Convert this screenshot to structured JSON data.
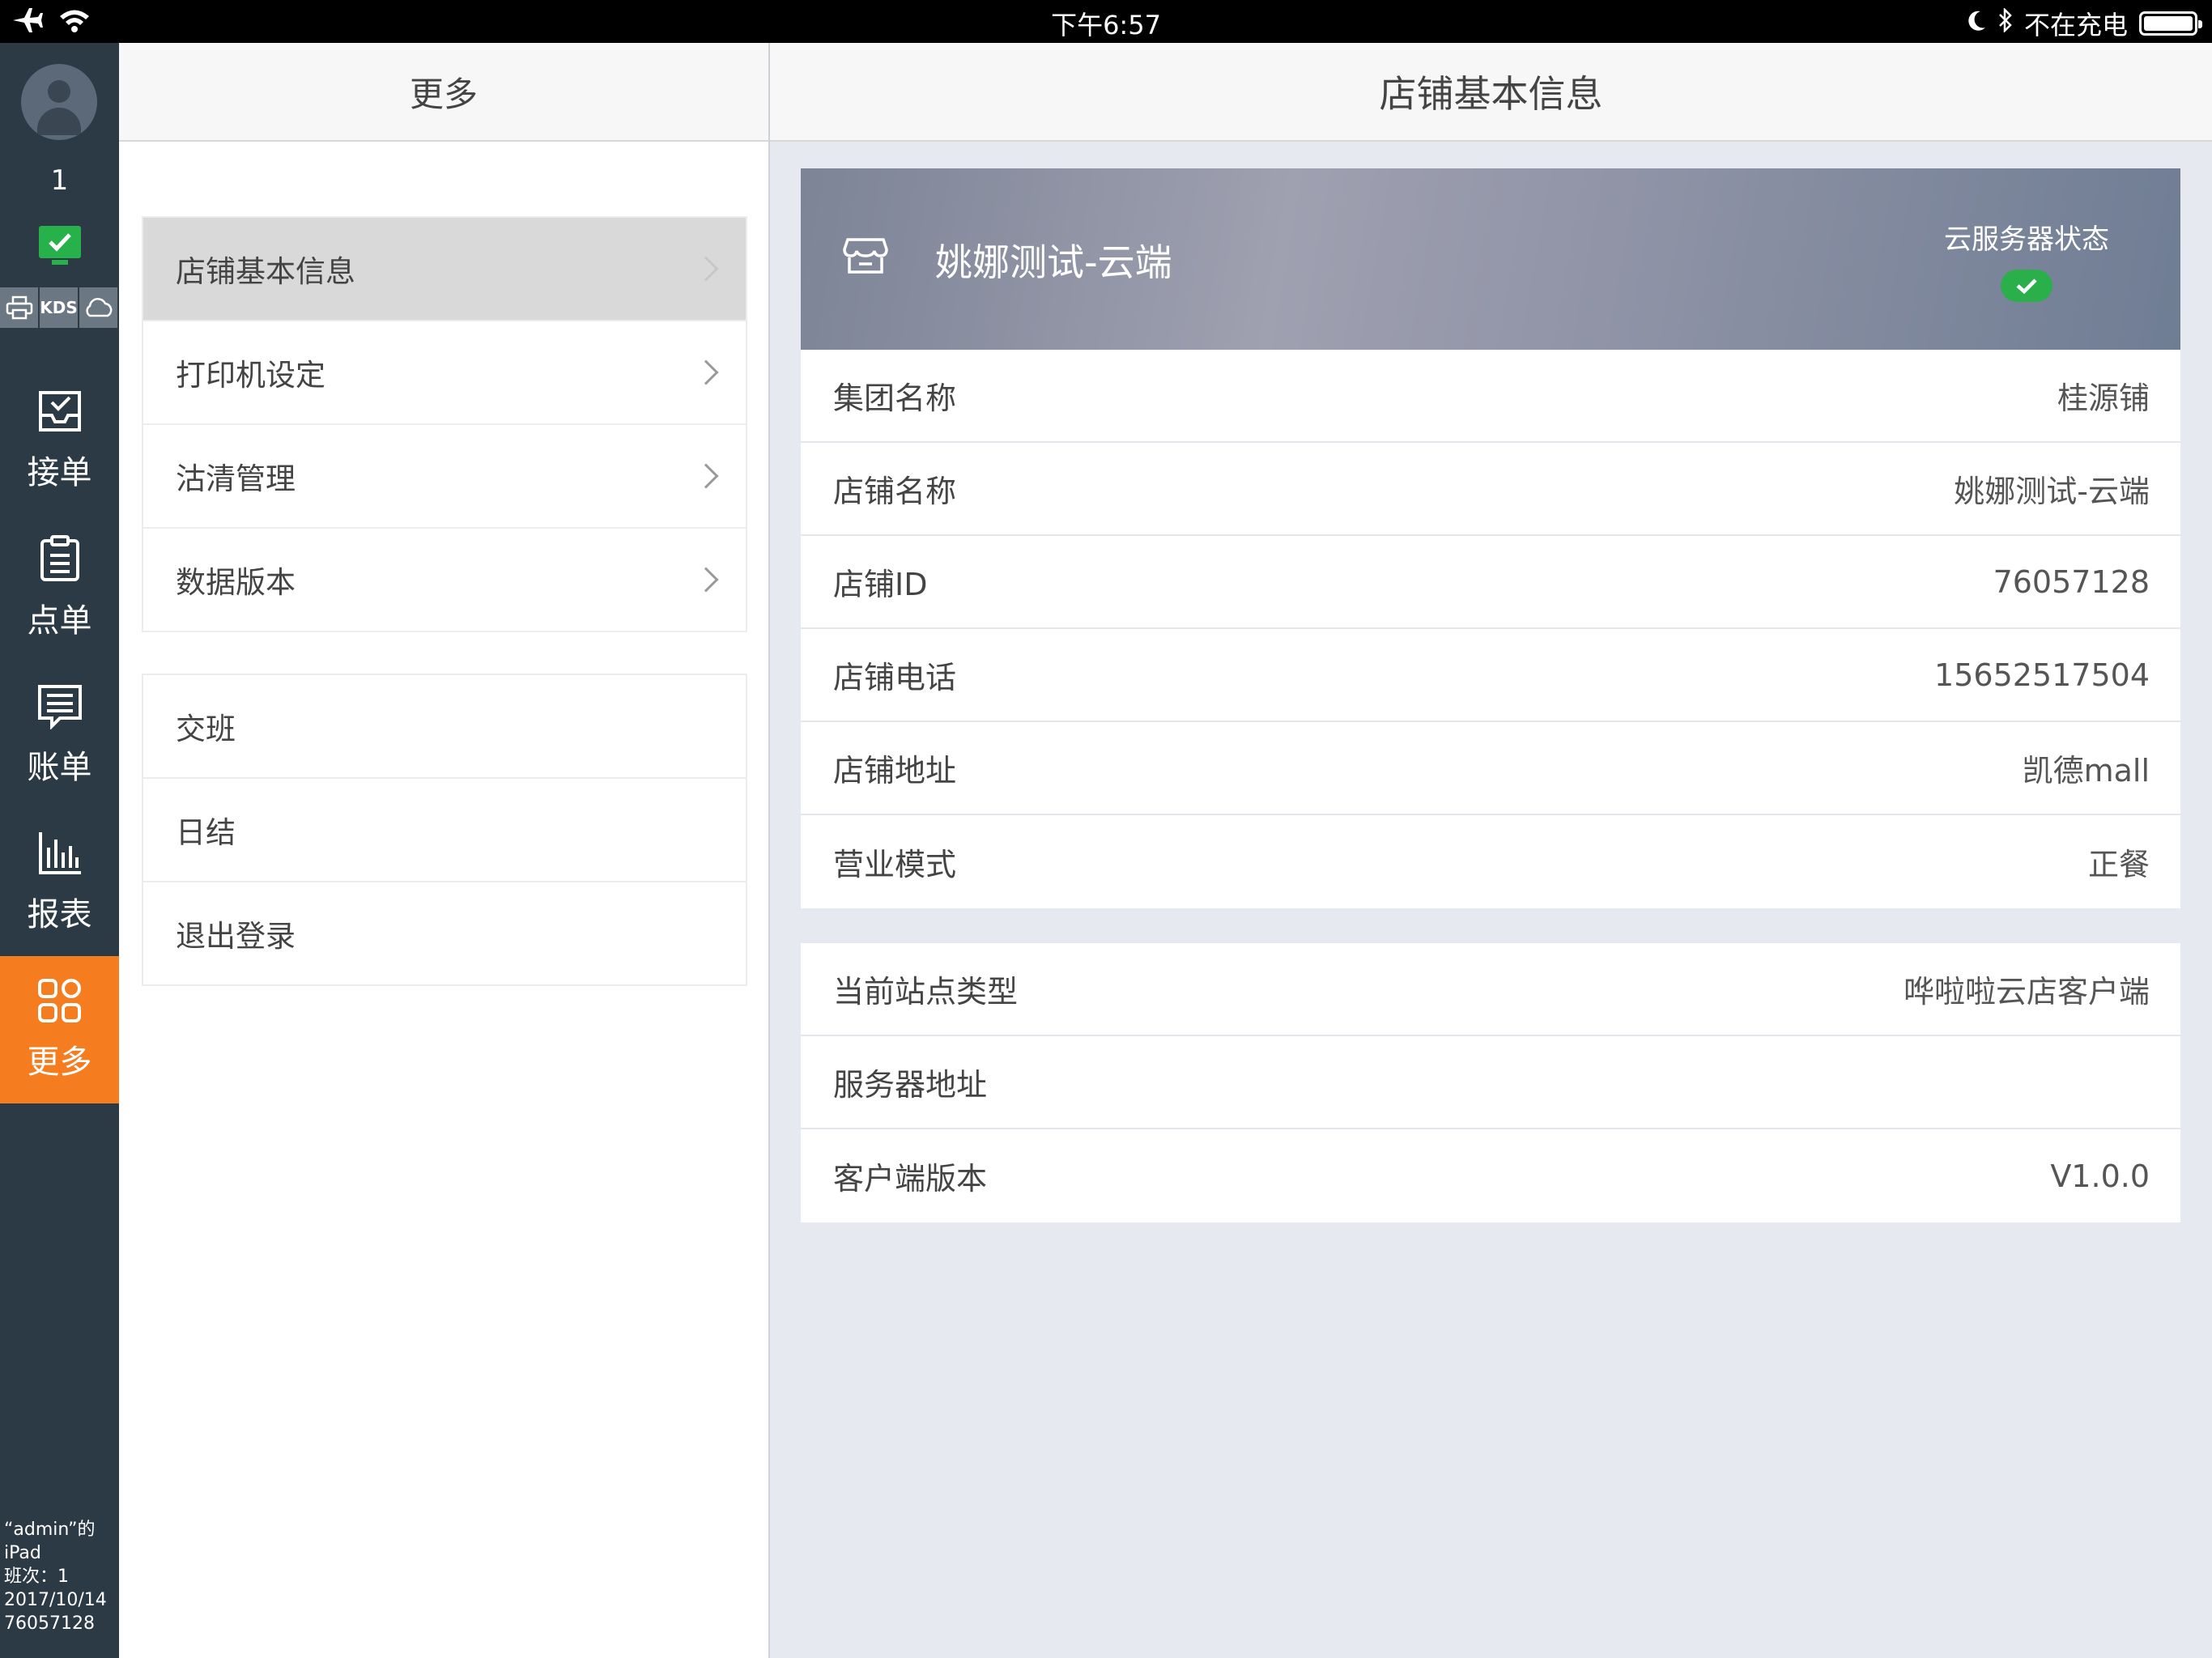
{
  "status_bar": {
    "time": "下午6:57",
    "charging_text": "不在充电",
    "icons": [
      "airplane-icon",
      "wifi-icon",
      "moon-icon",
      "bluetooth-icon",
      "battery-icon"
    ]
  },
  "sidebar": {
    "user_number": "1",
    "device_labels": {
      "kds": "KDS"
    },
    "nav": [
      {
        "label": "接单",
        "icon": "inbox-check-icon"
      },
      {
        "label": "点单",
        "icon": "clipboard-icon"
      },
      {
        "label": "账单",
        "icon": "receipt-icon"
      },
      {
        "label": "报表",
        "icon": "bar-chart-icon"
      },
      {
        "label": "更多",
        "icon": "grid-icon",
        "active": true
      }
    ],
    "footer": {
      "device_name": "“admin”的",
      "device_model": "iPad",
      "shift": "班次：1",
      "date": "2017/10/14",
      "store_id": "76057128"
    },
    "colors": {
      "background": "#2c3a46",
      "active": "#f57d1f",
      "online": "#27b14a"
    }
  },
  "more_menu": {
    "title": "更多",
    "group1": [
      {
        "label": "店铺基本信息",
        "selected": true
      },
      {
        "label": "打印机设定"
      },
      {
        "label": "沽清管理"
      },
      {
        "label": "数据版本"
      }
    ],
    "group2": [
      {
        "label": "交班"
      },
      {
        "label": "日结"
      },
      {
        "label": "退出登录"
      }
    ]
  },
  "detail": {
    "title": "店铺基本信息",
    "store_name": "姚娜测试-云端",
    "cloud_status_label": "云服务器状态",
    "store_info": [
      {
        "label": "集团名称",
        "value": "桂源铺"
      },
      {
        "label": "店铺名称",
        "value": "姚娜测试-云端"
      },
      {
        "label": "店铺ID",
        "value": "76057128"
      },
      {
        "label": "店铺电话",
        "value": "15652517504"
      },
      {
        "label": "店铺地址",
        "value": "凯德mall"
      },
      {
        "label": "营业模式",
        "value": "正餐"
      }
    ],
    "client_info": [
      {
        "label": "当前站点类型",
        "value": "哗啦啦云店客户端"
      },
      {
        "label": "服务器地址",
        "value": ""
      },
      {
        "label": "客户端版本",
        "value": "V1.0.0"
      }
    ]
  }
}
